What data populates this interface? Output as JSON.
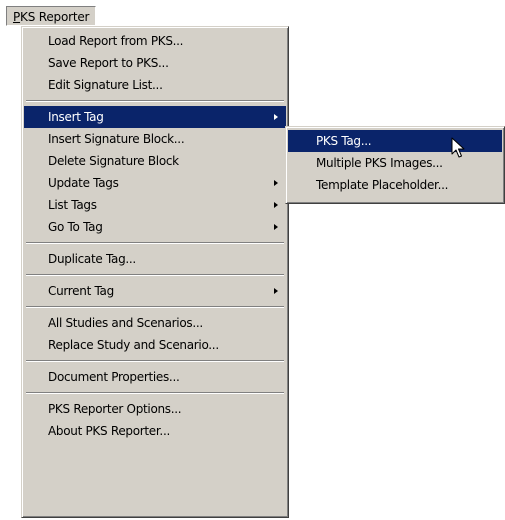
{
  "menubar": {
    "title_mnemonic": "P",
    "title_rest": "KS Reporter"
  },
  "main_menu": {
    "items": [
      {
        "label": "Load Report from PKS..."
      },
      {
        "label": "Save Report to PKS..."
      },
      {
        "label": "Edit Signature List..."
      },
      {
        "label": "Insert Tag"
      },
      {
        "label": "Insert Signature Block..."
      },
      {
        "label": "Delete Signature Block"
      },
      {
        "label": "Update Tags"
      },
      {
        "label": "List Tags"
      },
      {
        "label": "Go To Tag"
      },
      {
        "label": "Duplicate Tag..."
      },
      {
        "label": "Current Tag"
      },
      {
        "label": "All Studies and Scenarios..."
      },
      {
        "label": "Replace Study and Scenario..."
      },
      {
        "label": "Document Properties..."
      },
      {
        "label": "PKS Reporter Options..."
      },
      {
        "label": "About PKS Reporter..."
      }
    ]
  },
  "sub_menu": {
    "items": [
      {
        "label": "PKS Tag..."
      },
      {
        "label": "Multiple PKS Images..."
      },
      {
        "label": "Template Placeholder..."
      }
    ]
  },
  "colors": {
    "menu_bg": "#d4d0c8",
    "highlight_bg": "#0a246a",
    "highlight_text": "#ffffff"
  },
  "icons": {
    "submenu_arrow": "chevron-right-icon",
    "pointer": "mouse-pointer-icon"
  }
}
